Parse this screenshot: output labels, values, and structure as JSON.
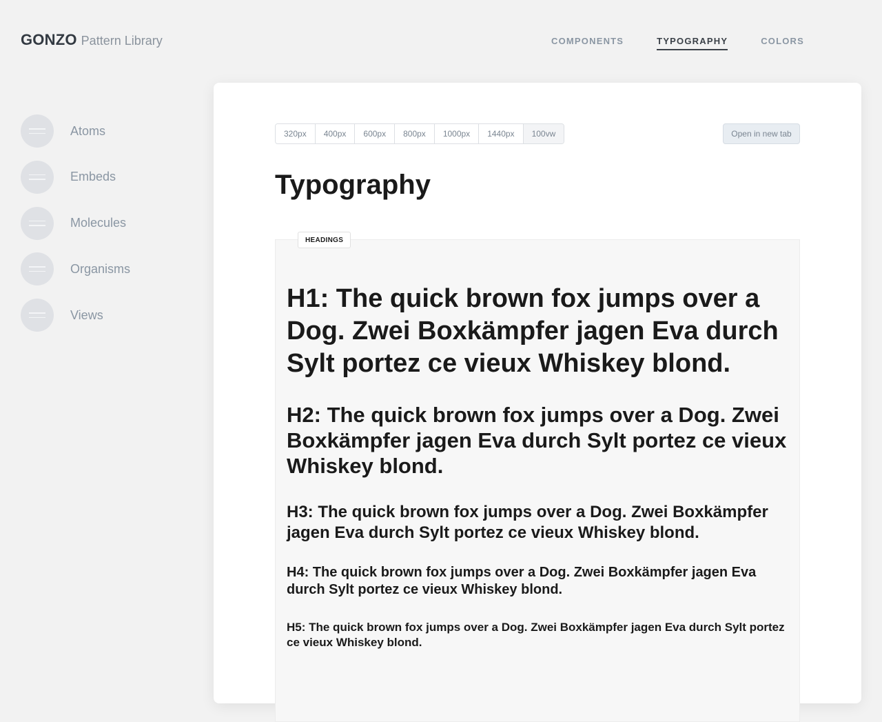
{
  "brand": {
    "name": "GONZO",
    "subtitle": "Pattern Library"
  },
  "topnav": {
    "items": [
      {
        "label": "COMPONENTS",
        "active": false
      },
      {
        "label": "TYPOGRAPHY",
        "active": true
      },
      {
        "label": "COLORS",
        "active": false
      }
    ]
  },
  "sidebar": {
    "items": [
      {
        "label": "Atoms"
      },
      {
        "label": "Embeds"
      },
      {
        "label": "Molecules"
      },
      {
        "label": "Organisms"
      },
      {
        "label": "Views"
      }
    ]
  },
  "viewport": {
    "options": [
      "320px",
      "400px",
      "600px",
      "800px",
      "1000px",
      "1440px",
      "100vw"
    ],
    "selected": "100vw",
    "open_new_tab_label": "Open in new tab"
  },
  "main": {
    "title": "Typography",
    "section_tag": "HEADINGS",
    "headings": {
      "h1": "H1: The quick brown fox jumps over a Dog. Zwei Boxkämpfer jagen Eva durch Sylt portez ce vieux Whiskey blond.",
      "h2": "H2: The quick brown fox jumps over a Dog. Zwei Boxkämpfer jagen Eva durch Sylt portez ce vieux Whiskey blond.",
      "h3": "H3: The quick brown fox jumps over a Dog. Zwei Boxkämpfer jagen Eva durch Sylt portez ce vieux Whiskey blond.",
      "h4": "H4: The quick brown fox jumps over a Dog. Zwei Boxkämpfer jagen Eva durch Sylt portez ce vieux Whiskey blond.",
      "h5": "H5: The quick brown fox jumps over a Dog. Zwei Boxkämpfer jagen Eva durch Sylt portez ce vieux Whiskey blond."
    }
  },
  "colors": {
    "background": "#f2f2f2",
    "card": "#ffffff",
    "text": "#1a1a1a",
    "muted": "#8a96a3",
    "active_nav": "#3b4148"
  }
}
